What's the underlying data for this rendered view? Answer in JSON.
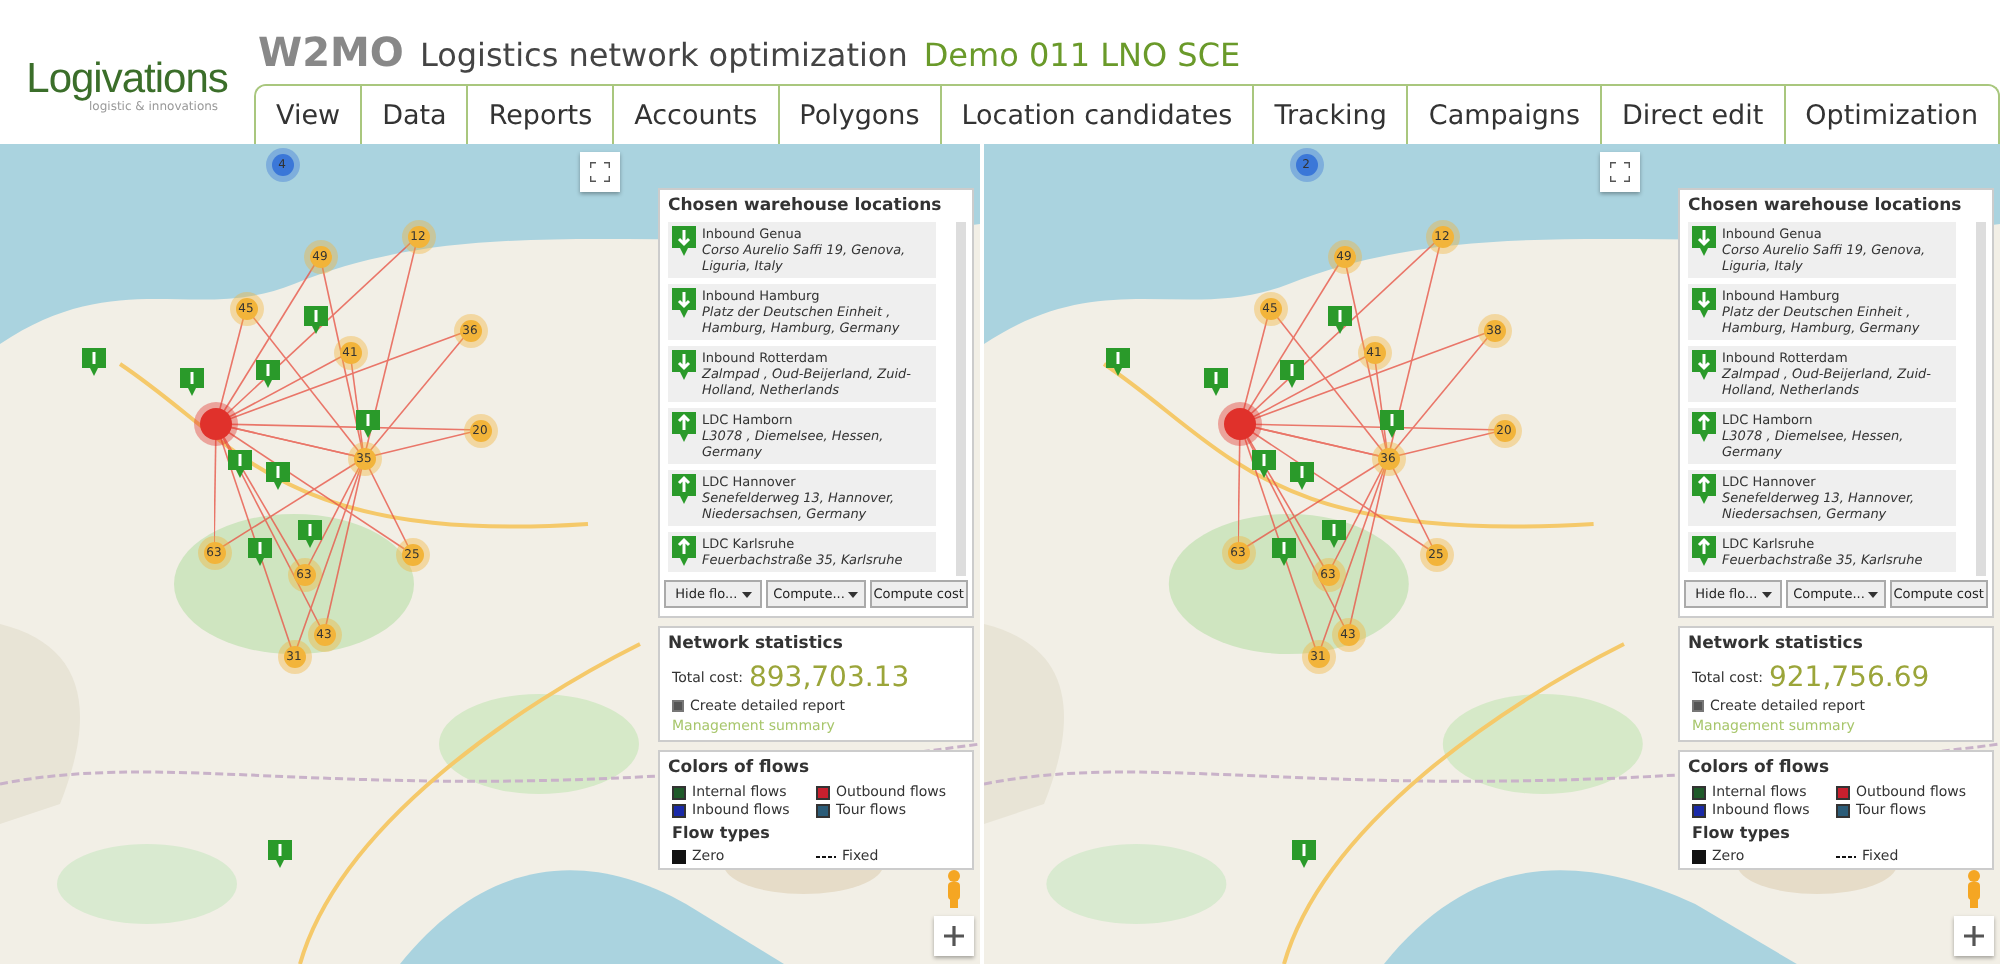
{
  "header": {
    "logo": "Logivations",
    "tagline": "logistic & innovations",
    "product": "W2MO",
    "title": "Logistics network optimization",
    "project": "Demo 011 LNO SCE"
  },
  "tabs": [
    {
      "label": "View",
      "selected": false
    },
    {
      "label": "Data",
      "selected": false
    },
    {
      "label": "Reports",
      "selected": false
    },
    {
      "label": "Accounts",
      "selected": false
    },
    {
      "label": "Polygons",
      "selected": false
    },
    {
      "label": "Location candidates",
      "selected": false
    },
    {
      "label": "Tracking",
      "selected": false
    },
    {
      "label": "Campaigns",
      "selected": false
    },
    {
      "label": "Direct edit",
      "selected": false
    },
    {
      "label": "Optimization",
      "selected": false
    }
  ],
  "maps": [
    {
      "clusters": [
        {
          "count": "4",
          "kind": "blue"
        },
        {
          "count": "49",
          "kind": "orange"
        },
        {
          "count": "12",
          "kind": "orange"
        },
        {
          "count": "45",
          "kind": "orange"
        },
        {
          "count": "41",
          "kind": "orange"
        },
        {
          "count": "36",
          "kind": "orange"
        },
        {
          "count": "35",
          "kind": "orange"
        },
        {
          "count": "20",
          "kind": "orange"
        },
        {
          "count": "63",
          "kind": "orange"
        },
        {
          "count": "63",
          "kind": "orange"
        },
        {
          "count": "25",
          "kind": "orange"
        },
        {
          "count": "43",
          "kind": "orange"
        },
        {
          "count": "31",
          "kind": "orange"
        },
        {
          "kind": "red"
        }
      ],
      "warehouses_title": "Chosen warehouse locations",
      "warehouses": [
        {
          "kind": "inbound",
          "name": "Inbound Genua",
          "address": "Corso Aurelio Saffi 19, Genova, Liguria, Italy"
        },
        {
          "kind": "inbound",
          "name": "Inbound Hamburg",
          "address": "Platz der Deutschen Einheit , Hamburg, Hamburg, Germany"
        },
        {
          "kind": "inbound",
          "name": "Inbound Rotterdam",
          "address": "Zalmpad , Oud-Beijerland, Zuid-Holland, Netherlands"
        },
        {
          "kind": "ldc",
          "name": "LDC Hamborn",
          "address": "L3078 , Diemelsee, Hessen, Germany"
        },
        {
          "kind": "ldc",
          "name": "LDC Hannover",
          "address": "Senefelderweg 13, Hannover, Niedersachsen, Germany"
        },
        {
          "kind": "ldc",
          "name": "LDC Karlsruhe",
          "address": "Feuerbachstraße 35, Karlsruhe"
        }
      ],
      "buttons": [
        {
          "label": "Hide flo...",
          "dropdown": true
        },
        {
          "label": "Compute...",
          "dropdown": true
        },
        {
          "label": "Compute cost",
          "dropdown": false
        }
      ],
      "stats_title": "Network statistics",
      "total_label": "Total cost:",
      "total_cost": "893,703.13",
      "detailed_report": {
        "label": "Create detailed report",
        "checked": true
      },
      "summary_link": "Management summary",
      "flows_title": "Colors of flows",
      "flow_colors": [
        {
          "label": "Internal flows",
          "color": "#1f5a2a"
        },
        {
          "label": "Outbound flows",
          "color": "#c8202e"
        },
        {
          "label": "Inbound flows",
          "color": "#1a2aa8"
        },
        {
          "label": "Tour flows",
          "color": "#2b5c78"
        }
      ],
      "flow_types_title": "Flow types",
      "flow_types": [
        {
          "label": "Zero",
          "kind": "solid"
        },
        {
          "label": "Fixed",
          "kind": "dashed"
        }
      ]
    },
    {
      "clusters": [
        {
          "count": "2",
          "kind": "blue"
        },
        {
          "count": "49",
          "kind": "orange"
        },
        {
          "count": "12",
          "kind": "orange"
        },
        {
          "count": "45",
          "kind": "orange"
        },
        {
          "count": "41",
          "kind": "orange"
        },
        {
          "count": "38",
          "kind": "orange"
        },
        {
          "count": "36",
          "kind": "orange"
        },
        {
          "count": "20",
          "kind": "orange"
        },
        {
          "count": "63",
          "kind": "orange"
        },
        {
          "count": "63",
          "kind": "orange"
        },
        {
          "count": "25",
          "kind": "orange"
        },
        {
          "count": "43",
          "kind": "orange"
        },
        {
          "count": "31",
          "kind": "orange"
        },
        {
          "kind": "red"
        }
      ],
      "warehouses_title": "Chosen warehouse locations",
      "warehouses": [
        {
          "kind": "inbound",
          "name": "Inbound Genua",
          "address": "Corso Aurelio Saffi 19, Genova, Liguria, Italy"
        },
        {
          "kind": "inbound",
          "name": "Inbound Hamburg",
          "address": "Platz der Deutschen Einheit , Hamburg, Hamburg, Germany"
        },
        {
          "kind": "inbound",
          "name": "Inbound Rotterdam",
          "address": "Zalmpad , Oud-Beijerland, Zuid-Holland, Netherlands"
        },
        {
          "kind": "ldc",
          "name": "LDC Hamborn",
          "address": "L3078 , Diemelsee, Hessen, Germany"
        },
        {
          "kind": "ldc",
          "name": "LDC Hannover",
          "address": "Senefelderweg 13, Hannover, Niedersachsen, Germany"
        },
        {
          "kind": "ldc",
          "name": "LDC Karlsruhe",
          "address": "Feuerbachstraße 35, Karlsruhe"
        }
      ],
      "buttons": [
        {
          "label": "Hide flo...",
          "dropdown": true
        },
        {
          "label": "Compute...",
          "dropdown": true
        },
        {
          "label": "Compute cost",
          "dropdown": false
        }
      ],
      "stats_title": "Network statistics",
      "total_label": "Total cost:",
      "total_cost": "921,756.69",
      "detailed_report": {
        "label": "Create detailed report",
        "checked": true
      },
      "summary_link": "Management summary",
      "flows_title": "Colors of flows",
      "flow_colors": [
        {
          "label": "Internal flows",
          "color": "#1f5a2a"
        },
        {
          "label": "Outbound flows",
          "color": "#c8202e"
        },
        {
          "label": "Inbound flows",
          "color": "#1a2aa8"
        },
        {
          "label": "Tour flows",
          "color": "#2b5c78"
        }
      ],
      "flow_types_title": "Flow types",
      "flow_types": [
        {
          "label": "Zero",
          "kind": "solid"
        },
        {
          "label": "Fixed",
          "kind": "dashed"
        }
      ]
    }
  ]
}
